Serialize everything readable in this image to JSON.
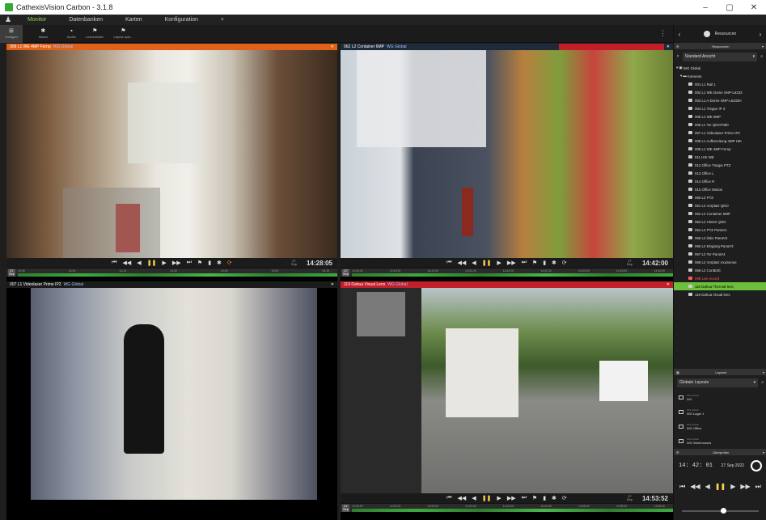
{
  "app": {
    "title": "CathexisVision Carbon - 3.1.8"
  },
  "window_controls": {
    "minimize": "–",
    "maximize": "▢",
    "close": "✕"
  },
  "menu": {
    "user_icon": "♟",
    "tabs": [
      "Monitor",
      "Datenbanken",
      "Karten",
      "Konfiguration"
    ],
    "add": "+"
  },
  "toolbar": {
    "left": [
      {
        "label": "Vorlagen",
        "icon": "⊞"
      },
      {
        "label": "Aktion",
        "icon": "✱"
      }
    ],
    "right": [
      {
        "label": "Archiv",
        "icon": "▪"
      },
      {
        "label": "Lesezeichen",
        "icon": "⚑"
      },
      {
        "label": "Layout spei...",
        "icon": "⚑"
      }
    ],
    "more": "⋮"
  },
  "panes": [
    {
      "title": "009 L1 WE 4MP Fernp",
      "group": "WG Global",
      "head_color": "#e0611a",
      "time": "14:28:05",
      "day": "27",
      "mon": "Sep",
      "ticks": [
        "13:45",
        "14:00",
        "14:15",
        "14:30",
        "14:45",
        "15:00",
        "15:15"
      ]
    },
    {
      "title": "062 L2 Container 6MP",
      "group": "WG Global",
      "head_color": "#1e2a3a",
      "time": "14:42:00",
      "day": "27",
      "mon": "Sep",
      "ticks": [
        "14:40:00",
        "14:40:30",
        "14:41:00",
        "14:41:30",
        "14:42:00",
        "14:42:30",
        "14:43:00",
        "14:43:30",
        "14:44:00"
      ]
    },
    {
      "title": "007 L1 Videolaser Prime IP2",
      "group": "WG Global",
      "head_color": "#1b1b1b"
    },
    {
      "title": "119 Dahua Visual Lens",
      "group": "WG Global",
      "head_color": "#c21f2a",
      "time": "14:53:52",
      "day": "27",
      "mon": "Sep",
      "ticks": [
        "14:52:00",
        "14:52:30",
        "14:53:00",
        "14:53:30",
        "14:54:00",
        "14:54:30",
        "14:55:00",
        "14:55:30",
        "14:56:00"
      ]
    }
  ],
  "video_controls": [
    "⏮",
    "◀◀",
    "◀",
    "❚❚",
    "▶",
    "▶▶",
    "⏭",
    "⚑",
    "▮",
    "✱",
    "⟳"
  ],
  "right_panel": {
    "resources_title": "Ressourcen",
    "view_label": "Standard Ansicht",
    "wg": "WG Global",
    "kameras": "Kameras",
    "cameras": [
      "001 L1 Rail 1",
      "002 L1 WE Dome SNP-L6233",
      "003 L1 A-Dome SNP-L6233H",
      "004 L1 Treppe IP 3",
      "005 L1 WE 6MP",
      "006 L1 Tor QNO7080",
      "007 L1 Videolaser Prime IP2",
      "008 L1 Aufbereitung 4MP HIK",
      "009 L1 WE 4MP Fernp",
      "011 HIK WE",
      "012 Office Treppe PTZ",
      "013 Office L",
      "014 Office R",
      "015 Office Motion",
      "060 L2 PTZ",
      "061 L2 Vorplatz QNO",
      "062 L2 Container 6MP",
      "063 L2 Hinten QNO",
      "064 L2 PTZ PanaV1",
      "065 L2 links PanaV2",
      "066 L2 Eingang PanaV3",
      "067 L2 Tor PanaV4",
      "068 L2 Vorplatz AxuSense",
      "069 L2 ContEntl.",
      "098 Live record",
      "118 Dahua Thermal lens",
      "119 Dahua Visual lens"
    ],
    "layouts_title": "Layouts",
    "layouts_select": "Globale Layouts",
    "layouts": [
      {
        "small": "WG Global",
        "name": "2x2"
      },
      {
        "small": "WG Global",
        "name": "WG Lager 1"
      },
      {
        "small": "WG Global",
        "name": "WG Office"
      },
      {
        "small": "WG Global",
        "name": "WG Warehouses"
      }
    ],
    "playback_title": "Überprüfen",
    "pb_time": "14: 42: 01",
    "pb_date": "27 Sep 2022",
    "pb_controls": [
      "⏮",
      "◀◀",
      "◀",
      "❚❚",
      "▶",
      "▶▶",
      "⏭"
    ]
  }
}
